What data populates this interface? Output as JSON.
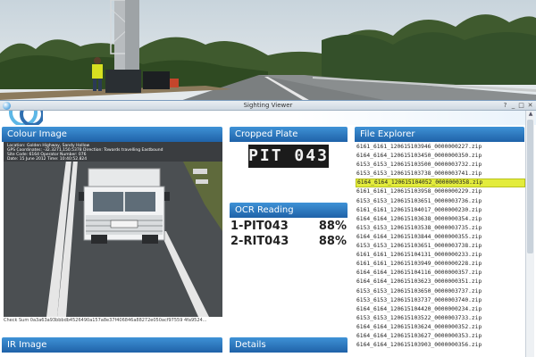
{
  "window": {
    "title": "Sighting Viewer",
    "controls": [
      "?",
      "_",
      "□",
      "✕"
    ]
  },
  "colour_image": {
    "heading": "Colour Image",
    "overlay_line1": "Location: Golden Highway, Sandy Hollow",
    "overlay_line2": "GPS Coordinates: -32.3271,150.5378  Direction: Towards travelling Eastbound",
    "overlay_line3": "Site Code: 6164   Operator Number: 076",
    "overlay_line4": "Date: 15 June 2012      Time: 10:40:52.824",
    "checksum": "Check Sum  0a3a63a93bbbdb4526490a157a8e37f406846a88272e050acf97559 4fa9524..."
  },
  "cropped_plate": {
    "heading": "Cropped Plate",
    "plate_text": "PIT 043"
  },
  "ocr_reading": {
    "heading": "OCR Reading",
    "results": [
      {
        "plate": "1-PIT043",
        "confidence": "88%"
      },
      {
        "plate": "2-RIT043",
        "confidence": "88%"
      }
    ]
  },
  "file_explorer": {
    "heading": "File Explorer",
    "selected_index": 5,
    "files": [
      "6161_6161_120615103946_0000000227.zip",
      "6164_6164_120615103450_0000000350.zip",
      "6153_6153_120615103500_0000003732.zip",
      "6153_6153_120615103738_0000003741.zip",
      "6164_6164_120615104052_0000000358.zip",
      "6161_6161_120615103958_0000000229.zip",
      "6153_6153_120615103651_0000003736.zip",
      "6161_6161_120615104017_0000000230.zip",
      "6164_6164_120615103638_0000000354.zip",
      "6153_6153_120615103538_0000003735.zip",
      "6164_6164_120615103844_0000000355.zip",
      "6153_6153_120615103651_0000003738.zip",
      "6161_6161_120615104131_0000000233.zip",
      "6161_6161_120615103949_0000000228.zip",
      "6164_6164_120615104116_0000000357.zip",
      "6164_6164_120615103623_0000000351.zip",
      "6153_6153_120615103650_0000003737.zip",
      "6153_6153_120615103737_0000003740.zip",
      "6164_6164_120615104420_0000000234.zip",
      "6153_6153_120615103522_0000003733.zip",
      "6164_6164_120615103624_0000000352.zip",
      "6164_6164_120615103627_0000000353.zip",
      "6164_6164_120615103903_0000000356.zip"
    ]
  },
  "ir_image": {
    "heading": "IR Image"
  },
  "details": {
    "heading": "Details"
  },
  "colors": {
    "panel_heading": "#2a74bd",
    "selected_row": "#e3ec3c"
  }
}
